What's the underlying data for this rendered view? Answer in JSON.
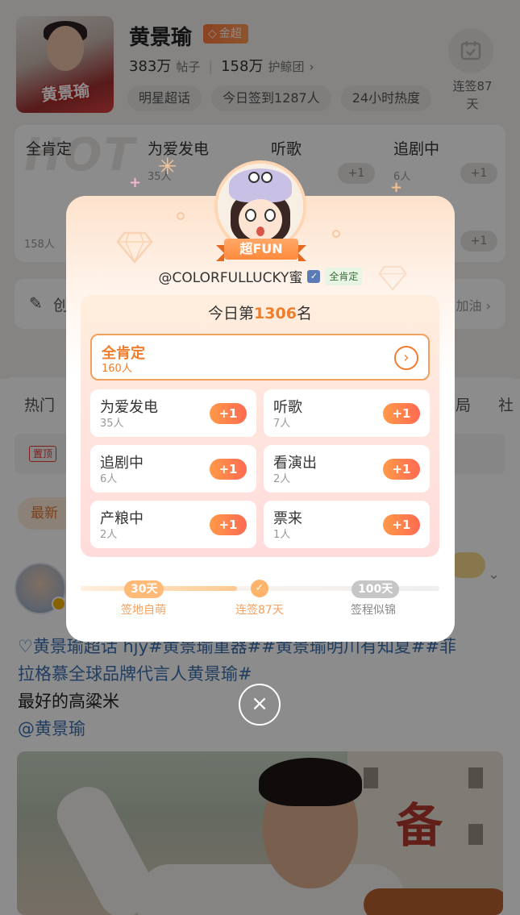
{
  "topic": {
    "name": "黄景瑜",
    "level_badge": "金超",
    "posts_count": "383万",
    "posts_unit": "帖子",
    "guard_count": "158万",
    "guard_unit": "护鲸团",
    "guard_arrow": "›",
    "cover_text": "黄景瑜",
    "tags": [
      "明星超话",
      "今日签到1287人",
      "24小时热度"
    ],
    "checkin_label": "连签87天"
  },
  "grid": {
    "watermark": "HOT",
    "cells": [
      {
        "title": "全肯定",
        "sub": "158人",
        "plus": "+1"
      },
      {
        "title": "为爱发电",
        "sub": "35人",
        "plus": "+1"
      },
      {
        "title": "听歌",
        "sub": "",
        "plus": "+1"
      },
      {
        "title": "追剧中",
        "sub": "6人",
        "plus": "+1"
      }
    ],
    "extra_plus": "+1"
  },
  "create_bar": {
    "label": "创",
    "right": "加油 ›"
  },
  "tabs": {
    "left": "热门",
    "right1": "局",
    "right2": "社"
  },
  "pinned": {
    "badge": "置顶"
  },
  "sort_chip": "最新",
  "post": {
    "text_line1": "♡黄景瑜超话 hjy#黄景瑜重器##黄景瑜明川有知夏##菲",
    "text_line2": "拉格慕全球品牌代言人黄景瑜#",
    "text_line3": "最好的高粱米",
    "text_line4": "@黄景瑜",
    "image_sign": "备"
  },
  "modal": {
    "ribbon": "超FUN",
    "username": "@COLORFULLUCKY蜜",
    "verified_mark": "✓",
    "affirm_badge": "全肯定",
    "rank_prefix": "今日第",
    "rank_number": "1306",
    "rank_suffix": "名",
    "main_option": {
      "title": "全肯定",
      "count": "160人",
      "arrow": "›"
    },
    "options": [
      {
        "title": "为爱发电",
        "count": "35人",
        "plus": "+1"
      },
      {
        "title": "听歌",
        "count": "7人",
        "plus": "+1"
      },
      {
        "title": "追剧中",
        "count": "6人",
        "plus": "+1"
      },
      {
        "title": "看演出",
        "count": "2人",
        "plus": "+1"
      },
      {
        "title": "产粮中",
        "count": "2人",
        "plus": "+1"
      },
      {
        "title": "票来",
        "count": "1人",
        "plus": "+1"
      }
    ],
    "progress": {
      "current_days": 87,
      "max_days": 100,
      "milestones": [
        {
          "chip": "30天",
          "label": "签地自萌",
          "status": "done"
        },
        {
          "chip": "✓",
          "label": "连签87天",
          "status": "current"
        },
        {
          "chip": "100天",
          "label": "签程似锦",
          "status": "todo"
        }
      ]
    },
    "close_icon": "×"
  },
  "colors": {
    "accent_orange": "#ef7d2d",
    "plus_gradient_start": "#ff9a48",
    "plus_gradient_end": "#ff6a52",
    "link_blue": "#3d6fb0"
  }
}
